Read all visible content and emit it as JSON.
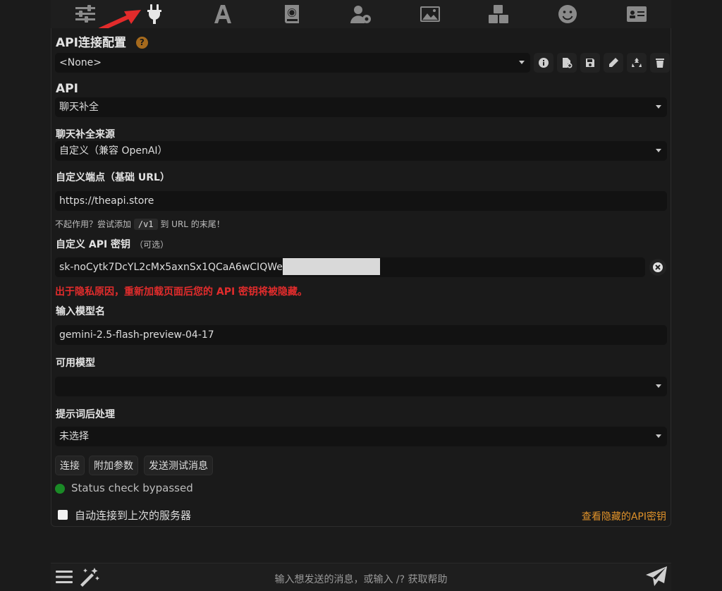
{
  "top_tabs": [
    {
      "icon": "sliders-icon",
      "active": false
    },
    {
      "icon": "plug-icon",
      "active": true
    },
    {
      "icon": "font-icon",
      "active": false
    },
    {
      "icon": "book-globe-icon",
      "active": false
    },
    {
      "icon": "user-gear-icon",
      "active": false
    },
    {
      "icon": "image-icon",
      "active": false
    },
    {
      "icon": "cubes-icon",
      "active": false
    },
    {
      "icon": "smiley-icon",
      "active": false
    },
    {
      "icon": "id-card-icon",
      "active": false
    }
  ],
  "connection_profile": {
    "title": "API连接配置",
    "help": "?",
    "selected": "<None>",
    "actions": [
      "info-icon",
      "file-add-icon",
      "save-icon",
      "pencil-icon",
      "recycle-icon",
      "trash-icon"
    ]
  },
  "api": {
    "title": "API",
    "selected": "聊天补全"
  },
  "chat_source": {
    "title": "聊天补全来源",
    "selected": "自定义（兼容 OpenAI）"
  },
  "endpoint": {
    "title": "自定义端点（基础 URL）",
    "value": "https://theapi.store",
    "hint_prefix": "不起作用？尝试添加",
    "hint_code": "/v1",
    "hint_suffix": "到 URL 的末尾！"
  },
  "api_key": {
    "title": "自定义 API 密钥",
    "optional": "（可选）",
    "value": "sk-noCytk7DcYL2cMx5axnSx1QCaA6wCIQWe",
    "warning": "出于隐私原因，重新加载页面后您的 API 密钥将被隐藏。"
  },
  "model_input": {
    "title": "输入模型名",
    "value": "gemini-2.5-flash-preview-04-17"
  },
  "available_models": {
    "title": "可用模型",
    "selected": ""
  },
  "postprocessing": {
    "title": "提示词后处理",
    "selected": "未选择"
  },
  "buttons": {
    "connect": "连接",
    "extra_params": "附加参数",
    "send_test": "发送测试消息"
  },
  "status": {
    "text": "Status check bypassed",
    "color": "#1a8a26"
  },
  "auto_connect": {
    "label": "自动连接到上次的服务器",
    "checked": false
  },
  "reveal_link": "查看隐藏的API密钥",
  "chat_input": {
    "placeholder": "输入想发送的消息，或输入 /? 获取帮助"
  },
  "colors": {
    "accent": "#e0922a",
    "warning": "#e12c2c",
    "help_badge": "#a66a1d"
  }
}
